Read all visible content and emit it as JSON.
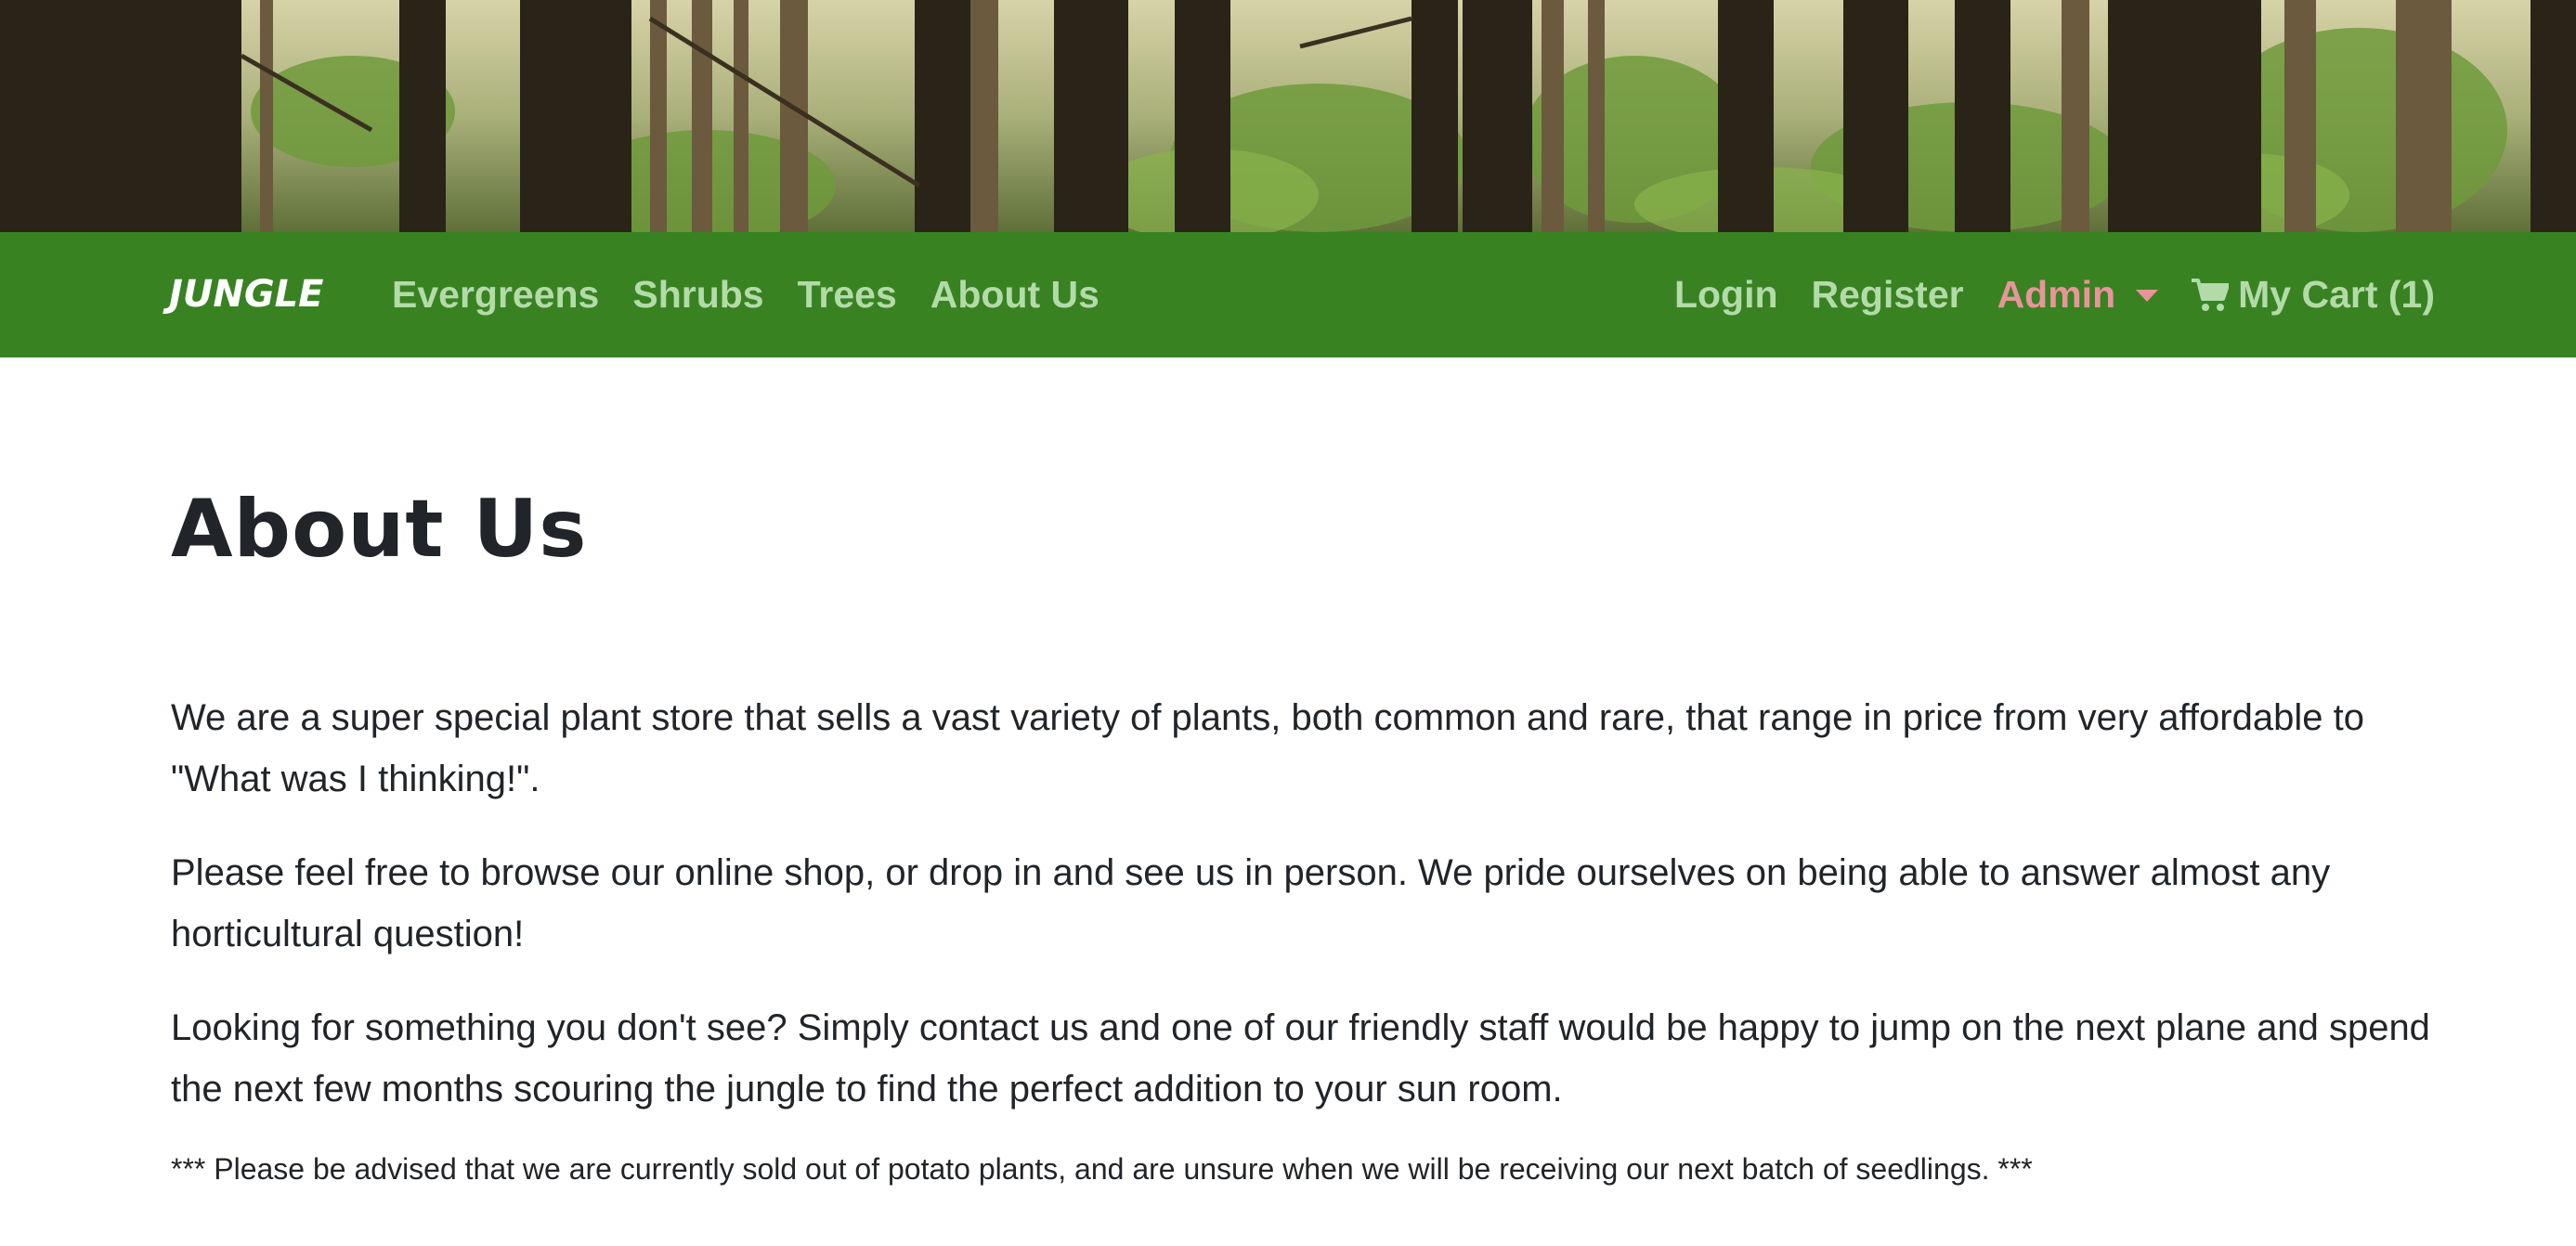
{
  "navbar": {
    "brand": "JUNGLE",
    "left_links": [
      "Evergreens",
      "Shrubs",
      "Trees",
      "About Us"
    ],
    "login": "Login",
    "register": "Register",
    "admin": "Admin",
    "cart": "My Cart (1)",
    "colors": {
      "background": "#388222",
      "link": "#b3dba8",
      "admin": "#e8949a"
    }
  },
  "banner": {
    "icon": "forest-image"
  },
  "page": {
    "title": "About Us",
    "paragraphs": [
      "We are a super special plant store that sells a vast variety of plants, both common and rare, that range in price from very affordable to \"What was I thinking!\".",
      "Please feel free to browse our online shop, or drop in and see us in person. We pride ourselves on being able to answer almost any horticultural question!",
      "Looking for something you don't see? Simply contact us and one of our friendly staff would be happy to jump on the next plane and spend the next few months scouring the jungle to find the perfect addition to your sun room."
    ],
    "notice": "*** Please be advised that we are currently sold out of potato plants, and are unsure when we will be receiving our next batch of seedlings. ***"
  }
}
